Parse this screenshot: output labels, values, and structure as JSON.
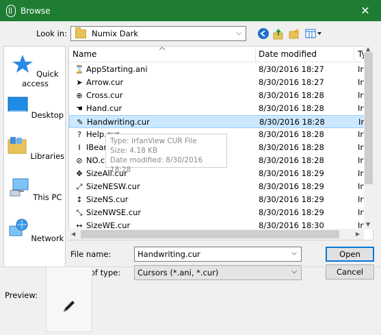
{
  "window": {
    "title": "Browse",
    "close": "✕"
  },
  "lookin": {
    "label": "Look in:",
    "value": "Numix Dark",
    "arrow": "⌵"
  },
  "nav": {
    "back": "back-icon",
    "up": "up-folder-icon",
    "newfolder": "new-folder-icon",
    "view": "view-menu-icon"
  },
  "places": [
    {
      "label": "Quick access",
      "icon": "star-icon"
    },
    {
      "label": "Desktop",
      "icon": "desktop-icon"
    },
    {
      "label": "Libraries",
      "icon": "libraries-icon"
    },
    {
      "label": "This PC",
      "icon": "computer-icon"
    },
    {
      "label": "Network",
      "icon": "network-icon"
    }
  ],
  "columns": {
    "name": "Name",
    "date": "Date modified",
    "type": "Ty"
  },
  "files": [
    {
      "name": "AppStarting.ani",
      "date": "8/30/2016 18:27",
      "type": "Irf",
      "icon": "⌛"
    },
    {
      "name": "Arrow.cur",
      "date": "8/30/2016 18:27",
      "type": "Irf",
      "icon": "➤"
    },
    {
      "name": "Cross.cur",
      "date": "8/30/2016 18:28",
      "type": "Irf",
      "icon": "⊕"
    },
    {
      "name": "Hand.cur",
      "date": "8/30/2016 18:28",
      "type": "Irf",
      "icon": "☚"
    },
    {
      "name": "Handwriting.cur",
      "date": "8/30/2016 18:28",
      "type": "Irf",
      "icon": "✎",
      "selected": true
    },
    {
      "name": "Help.cur",
      "date": "8/30/2016 18:28",
      "type": "Irf",
      "icon": "?"
    },
    {
      "name": "IBeam.cur",
      "date": "8/30/2016 18:28",
      "type": "Irf",
      "icon": "I"
    },
    {
      "name": "NO.cur",
      "date": "8/30/2016 18:28",
      "type": "Irf",
      "icon": "⊘"
    },
    {
      "name": "SizeAll.cur",
      "date": "8/30/2016 18:29",
      "type": "Irf",
      "icon": "✥"
    },
    {
      "name": "SizeNESW.cur",
      "date": "8/30/2016 18:29",
      "type": "Irf",
      "icon": "⤢"
    },
    {
      "name": "SizeNS.cur",
      "date": "8/30/2016 18:29",
      "type": "Irf",
      "icon": "↕"
    },
    {
      "name": "SizeNWSE.cur",
      "date": "8/30/2016 18:29",
      "type": "Irf",
      "icon": "⤡"
    },
    {
      "name": "SizeWE.cur",
      "date": "8/30/2016 18:30",
      "type": "Irf",
      "icon": "↔"
    }
  ],
  "tooltip": {
    "type": "Type: IrfanView CUR File",
    "size": "Size: 4.18 KB",
    "date": "Date modified: 8/30/2016 18:28"
  },
  "filename": {
    "label": "File name:",
    "value": "Handwriting.cur"
  },
  "filetype": {
    "label": "Files of type:",
    "value": "Cursors (*.ani, *.cur)"
  },
  "buttons": {
    "open": "Open",
    "cancel": "Cancel"
  },
  "preview": {
    "label": "Preview:"
  },
  "colors": {
    "titlebar": "#1e7d32",
    "selection": "#cce8ff",
    "accent": "#0078d7"
  }
}
